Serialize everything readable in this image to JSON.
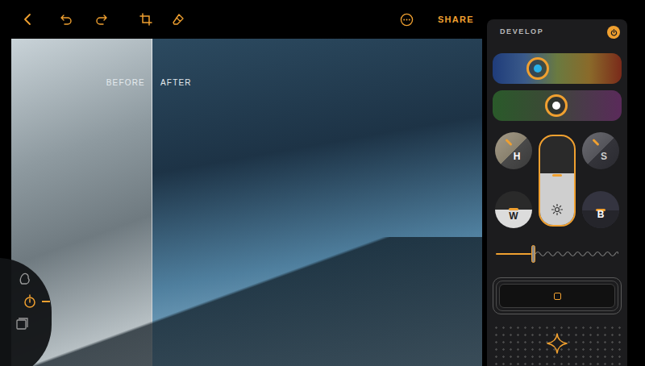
{
  "toolbar": {
    "share": "SHARE"
  },
  "photo": {
    "before_label": "BEFORE",
    "after_label": "AFTER",
    "split": 0.3
  },
  "tool_wheel": {
    "items": [
      {
        "selected": false
      },
      {
        "selected": true
      },
      {
        "selected": false
      }
    ]
  },
  "develop": {
    "title": "DEVELOP",
    "power_on": true,
    "color_sliders": [
      {
        "level": 0.32
      },
      {
        "level": 0.49
      }
    ],
    "dials": {
      "hue": {
        "label": "H"
      },
      "saturation": {
        "label": "S"
      },
      "whites": {
        "label": "W",
        "level": 0.5
      },
      "blacks": {
        "label": "B",
        "level": 0.47
      }
    },
    "brightness": {
      "level": 0.58
    },
    "wave_slider": {
      "level": 0.29
    }
  }
}
